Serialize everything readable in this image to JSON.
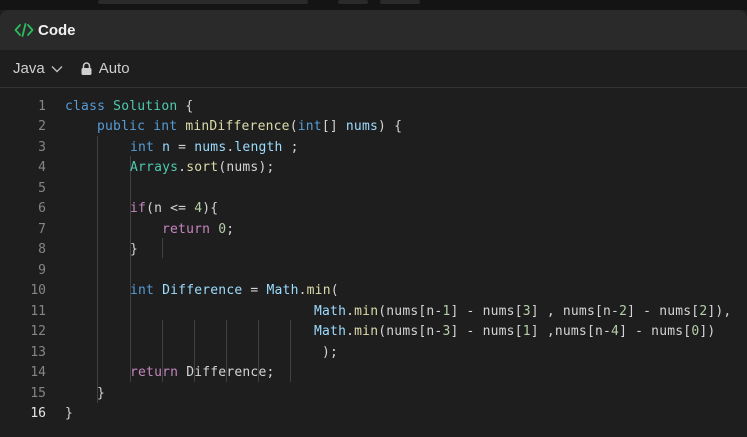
{
  "header": {
    "title": "Code",
    "icon": "code-brackets-icon",
    "accent": "#2cbb5d"
  },
  "toolbar": {
    "language": "Java",
    "mode": "Auto"
  },
  "editor": {
    "line_numbers": [
      "1",
      "2",
      "3",
      "4",
      "5",
      "6",
      "7",
      "8",
      "9",
      "10",
      "11",
      "12",
      "13",
      "14",
      "15",
      "16"
    ],
    "active_line": "16",
    "l1": {
      "a": "class",
      "b": " ",
      "c": "Solution",
      "d": " {"
    },
    "l2": {
      "a": "public",
      "b": " ",
      "c": "int",
      "d": " ",
      "e": "minDifference",
      "f": "(",
      "g": "int",
      "h": "[] ",
      "i": "nums",
      "j": ") {"
    },
    "l3": {
      "a": "int",
      "b": " ",
      "c": "n",
      "d": " = ",
      "e": "nums",
      "f": ".",
      "g": "length",
      "h": " ;"
    },
    "l4": {
      "a": "Arrays",
      "b": ".",
      "c": "sort",
      "d": "(nums);"
    },
    "l6": {
      "a": "if",
      "b": "(n <= ",
      "c": "4",
      "d": "){"
    },
    "l7": {
      "a": "return",
      "b": " ",
      "c": "0",
      "d": ";"
    },
    "l8": {
      "a": "}"
    },
    "l10": {
      "a": "int",
      "b": " ",
      "c": "Difference",
      "d": " = ",
      "e": "Math",
      "f": ".",
      "g": "min",
      "h": "("
    },
    "l11": {
      "a": "Math",
      "b": ".",
      "c": "min",
      "d": "(nums[n-",
      "e": "1",
      "f": "] - nums[",
      "g": "3",
      "h": "] , nums[n-",
      "i": "2",
      "j": "] - nums[",
      "k": "2",
      "l": "]),"
    },
    "l12": {
      "a": "Math",
      "b": ".",
      "c": "min",
      "d": "(nums[n-",
      "e": "3",
      "f": "] - nums[",
      "g": "1",
      "h": "] ,nums[n-",
      "i": "4",
      "j": "] - nums[",
      "k": "0",
      "l": "])"
    },
    "l13": {
      "a": ");"
    },
    "l14": {
      "a": "return",
      "b": " Difference;"
    },
    "l15": {
      "a": "}"
    },
    "l16": {
      "a": "}"
    }
  }
}
